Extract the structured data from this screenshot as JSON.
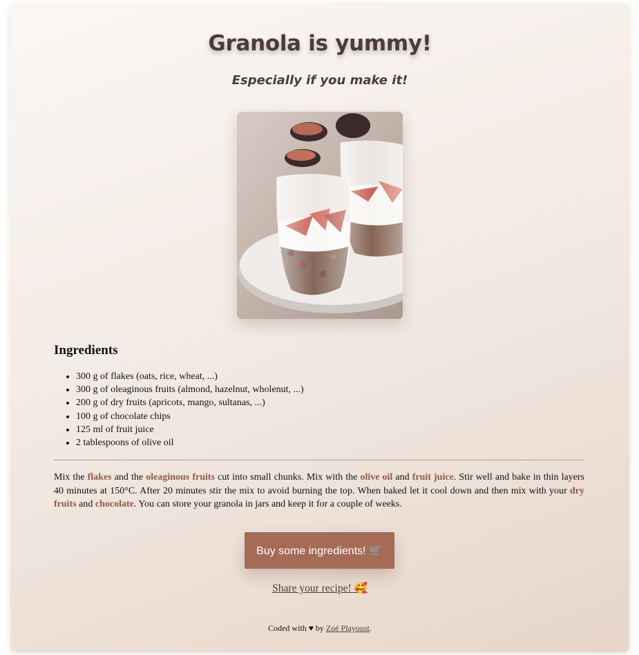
{
  "header": {
    "title": "Granola is yummy!",
    "subtitle": "Especially if you make it!"
  },
  "ingredients": {
    "heading": "Ingredients",
    "items": [
      "300 g of flakes (oats, rice, wheat, ...)",
      "300 g of oleaginous fruits (almond, hazelnut, wholenut, ...)",
      "200 g of dry fruits (apricots, mango, sultanas, ...)",
      "100 g of chocolate chips",
      "125 ml of fruit juice",
      "2 tablespoons of olive oil"
    ]
  },
  "method": {
    "t1": "Mix the ",
    "h1": "flakes",
    "t2": " and the ",
    "h2": "oleaginous fruits",
    "t3": " cut into small chunks. Mix with the ",
    "h3": "olive oil",
    "t4": " and ",
    "h4": "fruit juice",
    "t5": ". Stir well and bake in thin layers 40 minutes at 150°C. After 20 minutes stir the mix to avoid burning the top. When baked let it cool down and then mix with your ",
    "h5": "dry fruits",
    "t6": " and ",
    "h6": "chocolate",
    "t7": ". You can store your granola in jars and keep it for a couple of weeks."
  },
  "actions": {
    "buy_label": "Buy some ingredients! 🛒",
    "share_label": "Share your recipe! 🥰"
  },
  "footer": {
    "prefix": "Coded with ♥ by ",
    "author": "Zoé Playoust",
    "suffix": "."
  },
  "colors": {
    "accent": "#a56b57",
    "highlight": "#8d5a48",
    "heading": "#4a3c3a"
  },
  "icons": {
    "cart": "shopping-cart-icon",
    "share": "smiling-face-hearts-icon",
    "heart": "heart-icon"
  }
}
